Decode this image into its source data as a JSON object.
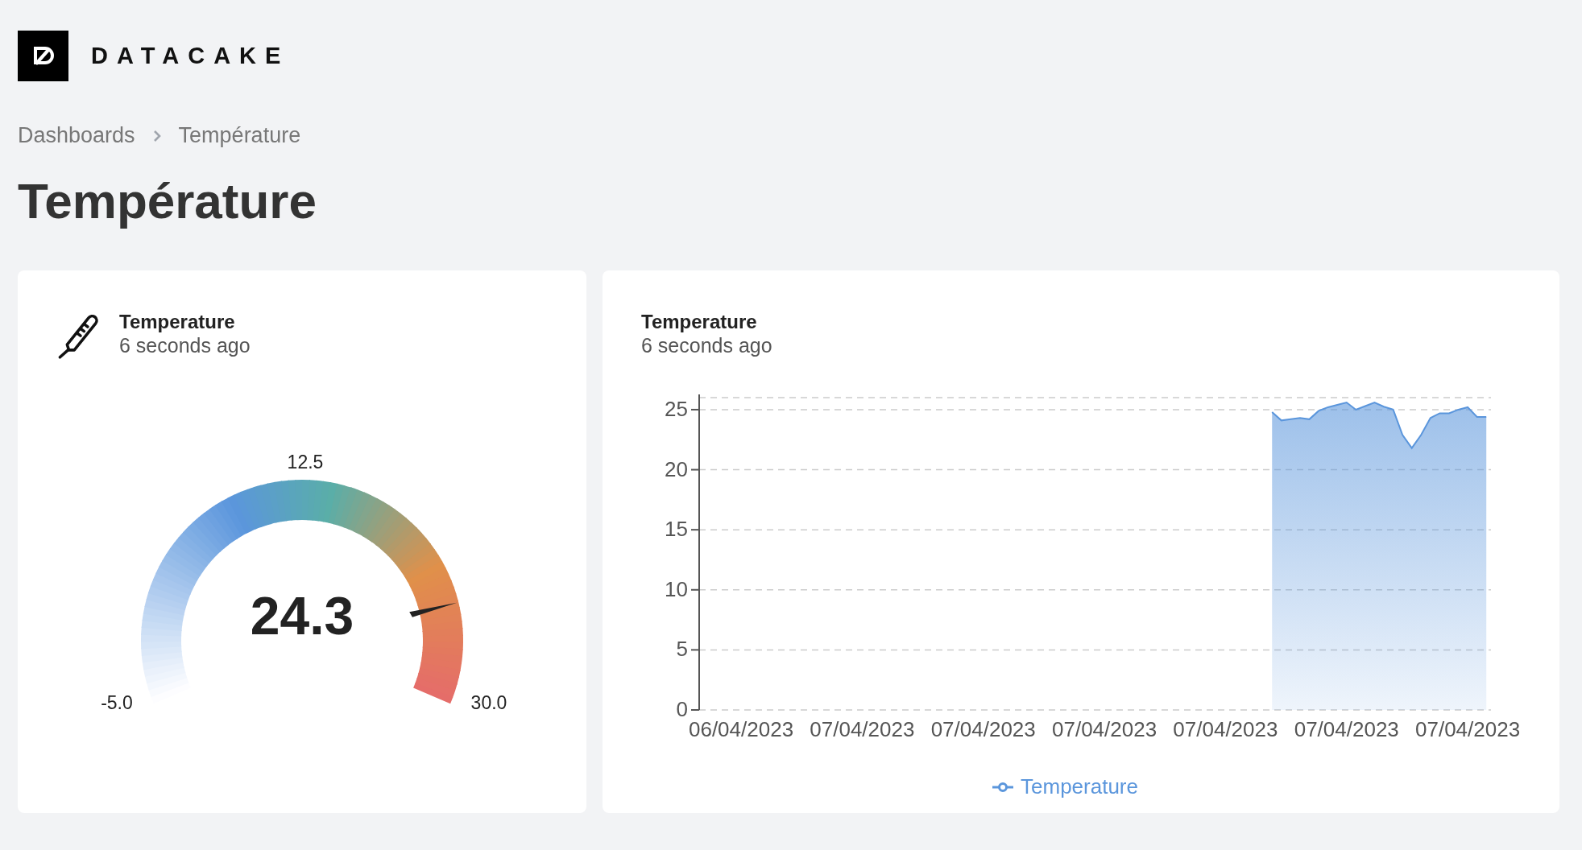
{
  "brand": {
    "name": "DATACAKE"
  },
  "breadcrumb": [
    "Dashboards",
    "Température"
  ],
  "page_title": "Température",
  "gauge_card": {
    "title": "Temperature",
    "subtitle": "6 seconds ago",
    "value": "24.3",
    "min_label": "-5.0",
    "mid_label": "12.5",
    "max_label": "30.0",
    "level": 0.837
  },
  "chart_card": {
    "title": "Temperature",
    "subtitle": "6 seconds ago",
    "chart_data": {
      "type": "area",
      "grid": true,
      "ylim": [
        0,
        26
      ],
      "yticks": [
        0,
        5,
        10,
        15,
        20,
        25
      ],
      "categories": [
        null,
        null,
        null,
        null,
        "06/04/2023",
        null,
        null,
        null,
        null,
        null,
        null,
        null,
        null,
        null,
        null,
        null,
        null,
        "07/04/2023",
        null,
        null,
        null,
        null,
        null,
        null,
        null,
        null,
        null,
        null,
        null,
        null,
        "07/04/2023",
        null,
        null,
        null,
        null,
        null,
        null,
        null,
        null,
        null,
        null,
        null,
        null,
        "07/04/2023",
        null,
        null,
        null,
        null,
        null,
        null,
        null,
        null,
        null,
        null,
        null,
        null,
        "07/04/2023",
        null,
        null,
        null,
        null,
        null,
        null,
        null,
        null,
        null,
        null,
        null,
        null,
        "07/04/2023",
        null,
        null,
        null,
        null,
        null,
        null,
        null,
        null,
        null,
        null,
        null,
        null,
        "07/04/2023",
        null,
        null
      ],
      "series": [
        {
          "name": "Temperature",
          "color": "#5b96dc",
          "values": [
            null,
            null,
            null,
            null,
            null,
            null,
            null,
            null,
            null,
            null,
            null,
            null,
            null,
            null,
            null,
            null,
            null,
            null,
            null,
            null,
            null,
            null,
            null,
            null,
            null,
            null,
            null,
            null,
            null,
            null,
            null,
            null,
            null,
            null,
            null,
            null,
            null,
            null,
            null,
            null,
            null,
            null,
            null,
            null,
            null,
            null,
            null,
            null,
            null,
            null,
            null,
            null,
            null,
            null,
            null,
            null,
            null,
            null,
            null,
            null,
            null,
            24.8,
            24.1,
            24.2,
            24.3,
            24.2,
            24.9,
            25.2,
            25.4,
            25.6,
            25.0,
            25.3,
            25.6,
            25.25,
            25.0,
            22.9,
            21.8,
            22.9,
            24.3,
            24.7,
            24.7,
            25.0,
            25.2,
            24.4,
            24.4
          ]
        }
      ]
    }
  }
}
